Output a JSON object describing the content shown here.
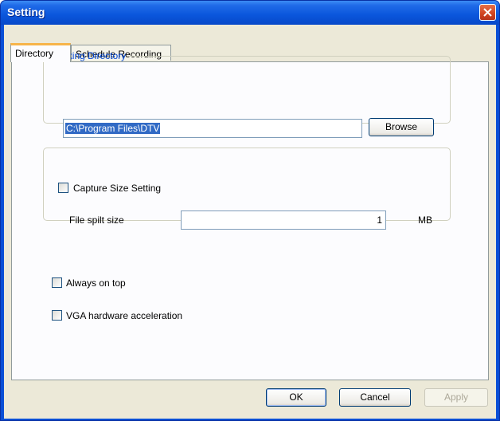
{
  "window": {
    "title": "Setting"
  },
  "tabs": [
    {
      "label": "Directory",
      "active": true
    },
    {
      "label": "Schedule Recording",
      "active": false
    }
  ],
  "working_directory": {
    "legend": "Working Directory",
    "path_value": "C:\\Program Files\\DTV",
    "browse_label": "Browse"
  },
  "capture_size": {
    "checkbox_label": "Capture Size Setting",
    "checked": false,
    "file_split_label": "File spilt size",
    "file_split_value": "1",
    "unit": "MB"
  },
  "options": {
    "always_on_top_label": "Always on top",
    "always_on_top_checked": false,
    "vga_label": "VGA hardware acceleration",
    "vga_checked": false
  },
  "buttons": {
    "ok": "OK",
    "cancel": "Cancel",
    "apply": "Apply"
  },
  "icons": {
    "close": "close-icon"
  },
  "colors": {
    "titlebar": "#0a56dc",
    "dialog_bg": "#ece9d8",
    "selection": "#316ac5",
    "active_tab_accent": "#f7b44a"
  }
}
